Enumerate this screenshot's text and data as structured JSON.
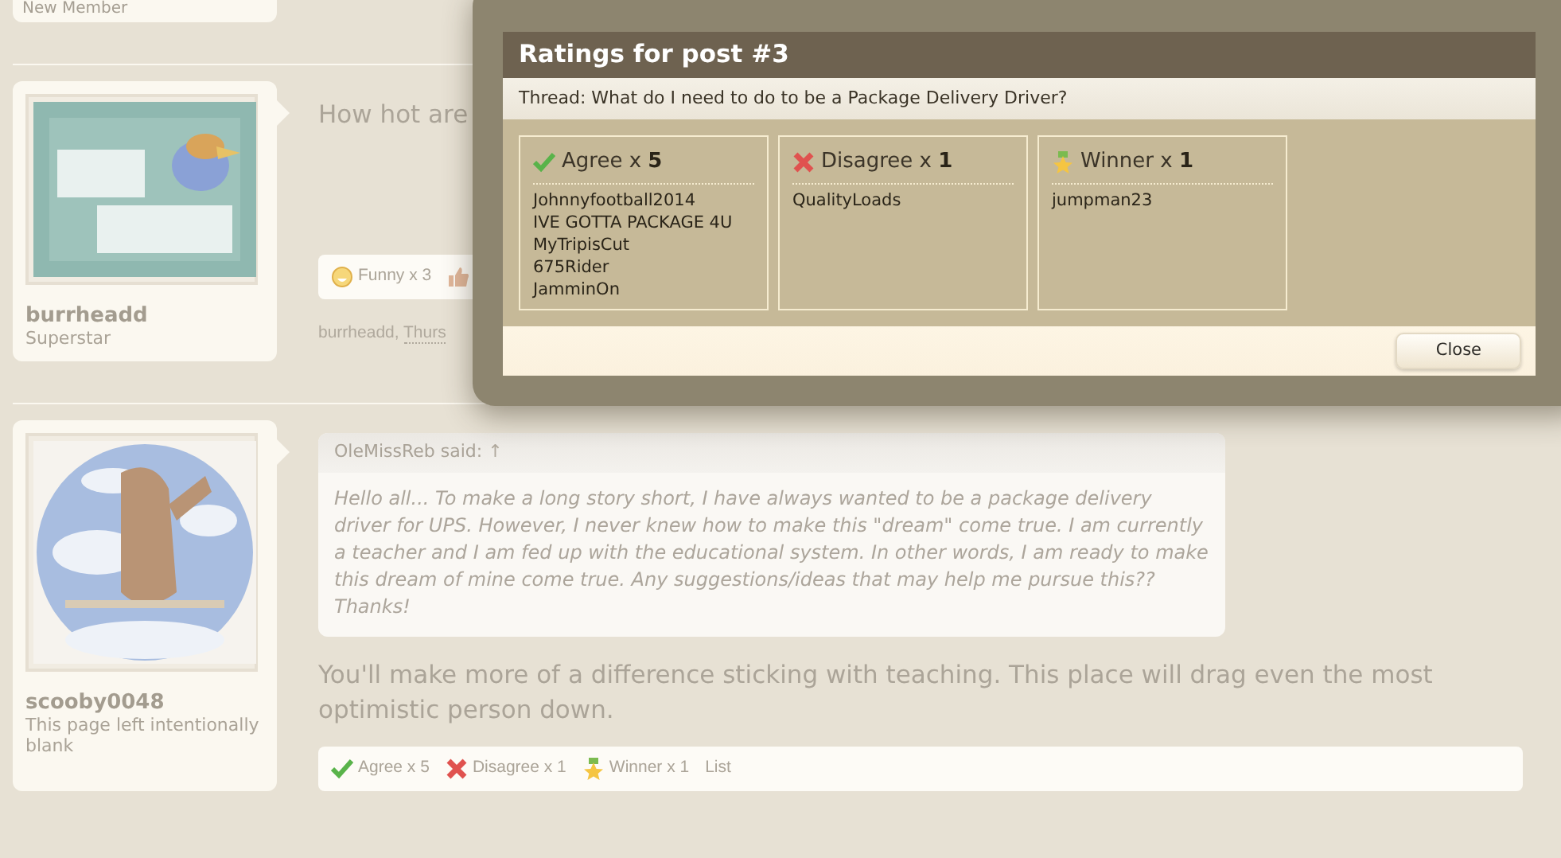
{
  "previous_post": {
    "user_title": "New Member"
  },
  "posts": [
    {
      "username": "burrheadd",
      "user_title": "Superstar",
      "avatar": {
        "kind": "picture"
      },
      "message": "How hot are",
      "ratings": [
        {
          "kind": "funny",
          "label": "Funny x 3"
        },
        {
          "kind": "like"
        }
      ],
      "meta": {
        "author": "burrheadd,",
        "date": "Thurs"
      }
    },
    {
      "username": "scooby0048",
      "user_title": "This page left intentionally blank",
      "avatar": {
        "kind": "picture"
      },
      "quote": {
        "author": "OleMissReb said:",
        "link": "↑",
        "text": "Hello all... To make a long story short, I have always wanted to be a package delivery driver for UPS. However, I never knew how to make this \"dream\" come true. I am currently a teacher and I am fed up with the educational system. In other words, I am ready to make this dream of mine come true. Any suggestions/ideas that may help me pursue this?? Thanks!"
      },
      "message": "You'll make more of a difference sticking with teaching. This place will drag even the most optimistic person down.",
      "ratings": [
        {
          "kind": "agree",
          "label": "Agree x 5"
        },
        {
          "kind": "disagree",
          "label": "Disagree x 1"
        },
        {
          "kind": "winner",
          "label": "Winner x 1"
        }
      ],
      "list_link": "List"
    }
  ],
  "dialog": {
    "title": "Ratings for post #3",
    "thread_label": "Thread:",
    "thread_link": "What do I need to do to be a Package Delivery Driver?",
    "groups": [
      {
        "kind": "agree",
        "heading": "Agree x **5**",
        "users": [
          "Johnnyfootball2014",
          "IVE GOTTA PACKAGE 4U",
          "MyTripisCut",
          "675Rider",
          "JamminOn"
        ]
      },
      {
        "kind": "disagree",
        "heading": "Disagree x **1**",
        "users": [
          "QualityLoads"
        ]
      },
      {
        "kind": "winner",
        "heading": "Winner x **1**",
        "users": [
          "jumpman23"
        ]
      }
    ],
    "close_button": "Close"
  }
}
